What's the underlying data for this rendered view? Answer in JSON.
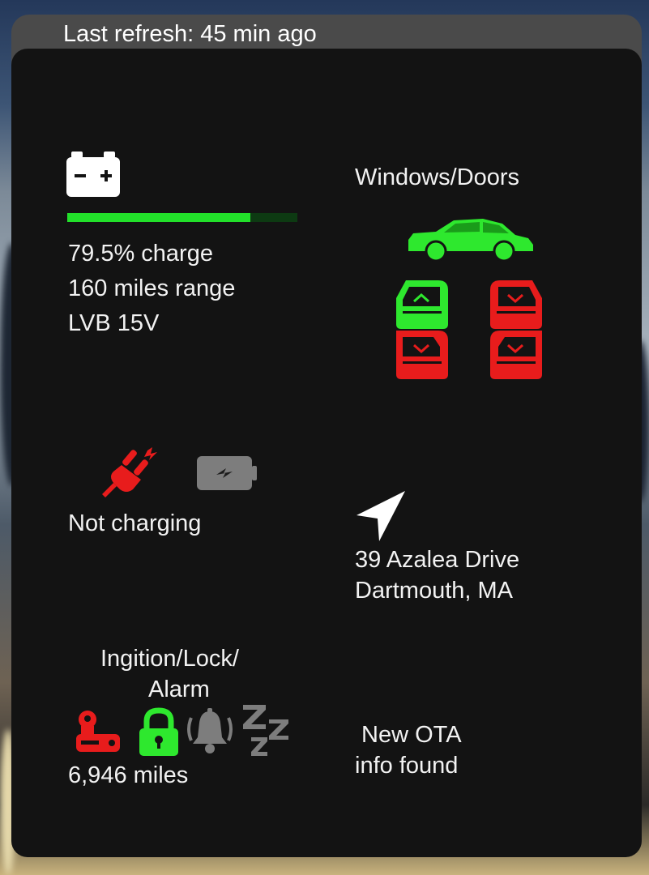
{
  "header": {
    "last_refresh": "Last refresh: 45 min ago"
  },
  "battery": {
    "icon": "car-battery-icon",
    "charge_fraction": 0.795,
    "charge_text": "79.5% charge",
    "range_text": "160 miles range",
    "lvb_text": "LVB 15V"
  },
  "windows_doors": {
    "title": "Windows/Doors",
    "car_icon": "car-side-icon",
    "car_color": "#2ee82e",
    "doors": [
      {
        "position": "front-left",
        "status": "closed",
        "color": "#2ee82e",
        "icon": "door-window-up-icon"
      },
      {
        "position": "front-right",
        "status": "open",
        "color": "#e81c1c",
        "icon": "door-window-down-icon"
      },
      {
        "position": "rear-left",
        "status": "open",
        "color": "#e81c1c",
        "icon": "door-window-down-icon"
      },
      {
        "position": "rear-right",
        "status": "open",
        "color": "#e81c1c",
        "icon": "door-window-down-icon"
      }
    ]
  },
  "charging": {
    "plug_icon": "plug-disconnected-icon",
    "plug_color": "#e81c1c",
    "battery_icon": "battery-charging-icon",
    "battery_color": "#7d7d7d",
    "status_text": "Not charging"
  },
  "location": {
    "icon": "navigation-arrow-icon",
    "line1": "39 Azalea Drive",
    "line2": "Dartmouth, MA"
  },
  "security": {
    "title_line1": "Ingition/Lock/",
    "title_line2": "Alarm",
    "ignition_icon": "key-icon",
    "ignition_color": "#e81c1c",
    "lock_icon": "lock-icon",
    "lock_color": "#2ee82e",
    "alarm_icon": "bell-ringing-icon",
    "alarm_color": "#7d7d7d",
    "sleep_icon": "sleep-zzz-icon",
    "sleep_color": "#7d7d7d",
    "odometer_text": "6,946 miles"
  },
  "ota": {
    "line1": "New OTA",
    "line2": "info found"
  }
}
